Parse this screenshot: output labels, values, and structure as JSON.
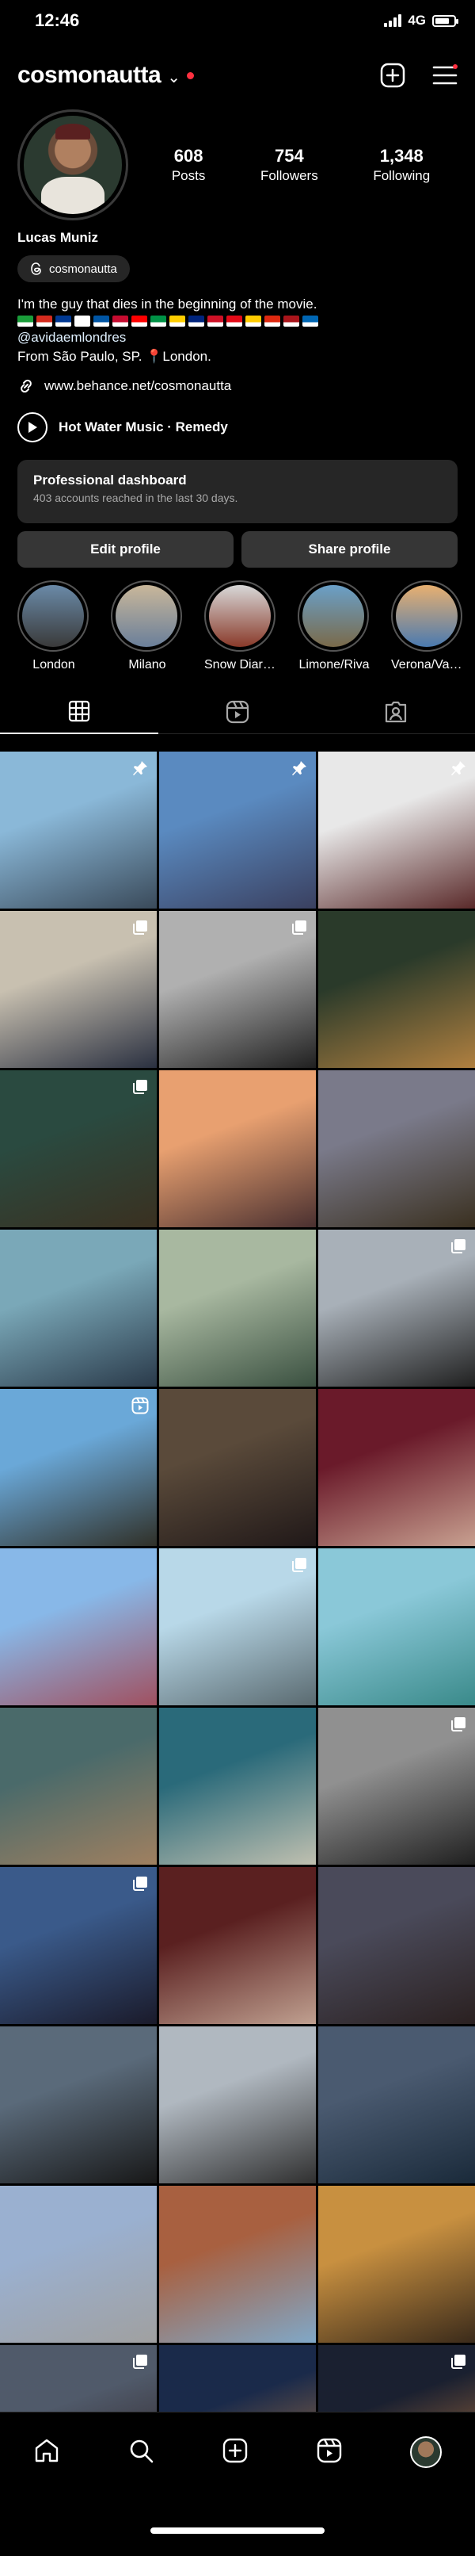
{
  "status": {
    "time": "12:46",
    "network": "4G",
    "battery_level": 0.75
  },
  "header": {
    "username": "cosmonautta",
    "icons": [
      "new-post-icon",
      "menu-icon"
    ]
  },
  "profile": {
    "stats": [
      {
        "value": "608",
        "label": "Posts"
      },
      {
        "value": "754",
        "label": "Followers"
      },
      {
        "value": "1,348",
        "label": "Following"
      }
    ],
    "name": "Lucas Muniz",
    "threads_handle": "cosmonautta",
    "bio_line1": "I'm the guy that dies in the beginning of the movie.",
    "flag_colors": [
      "#1a9d3a",
      "#d52b1e",
      "#003893",
      "#ffffff",
      "#0055a4",
      "#c60c30",
      "#ff0000",
      "#009246",
      "#ffce00",
      "#00247d",
      "#ce1126",
      "#e30a17",
      "#ffcc00",
      "#de2910",
      "#aa151b",
      "#0066b3"
    ],
    "mention": "@avidaemlondres",
    "location": "From São Paulo, SP. 📍London.",
    "link": "www.behance.net/cosmonautta",
    "music": "Hot Water Music · Remedy"
  },
  "dashboard": {
    "title": "Professional dashboard",
    "subtitle": "403 accounts reached in the last 30 days."
  },
  "buttons": {
    "edit": "Edit profile",
    "share": "Share profile"
  },
  "highlights": [
    {
      "label": "London",
      "colors": [
        "#6a8aa8",
        "#3a3a3a"
      ]
    },
    {
      "label": "Milano",
      "colors": [
        "#c9b79a",
        "#6a7f9a"
      ]
    },
    {
      "label": "Snow Diaries",
      "colors": [
        "#d8d8d8",
        "#8a3a2a"
      ]
    },
    {
      "label": "Limone/Riva",
      "colors": [
        "#6aa0c8",
        "#7a6a4a"
      ]
    },
    {
      "label": "Verona/Vale...",
      "colors": [
        "#e8b070",
        "#4a7ab0"
      ]
    }
  ],
  "tabs": [
    "grid-icon",
    "reels-icon",
    "tagged-icon"
  ],
  "posts": [
    {
      "desc": "sunset lake",
      "colors": [
        "#8ab8d8",
        "#3a4a5a"
      ],
      "badge": "pin-icon"
    },
    {
      "desc": "tower bridge couple",
      "colors": [
        "#5a8ac0",
        "#3a4060"
      ],
      "badge": "pin-icon"
    },
    {
      "desc": "ski goggles",
      "colors": [
        "#e8e8e8",
        "#5a2a2a"
      ],
      "badge": "pin-icon"
    },
    {
      "desc": "cafe sofa",
      "colors": [
        "#c8c0b0",
        "#2a3040"
      ],
      "badge": "carousel-icon"
    },
    {
      "desc": "mirror selfie bw",
      "colors": [
        "#b0b0b0",
        "#202020"
      ],
      "badge": "carousel-icon"
    },
    {
      "desc": "pub beer",
      "colors": [
        "#2a3a2a",
        "#b08040"
      ],
      "badge": ""
    },
    {
      "desc": "canal trees",
      "colors": [
        "#2a4a40",
        "#3a3020"
      ],
      "badge": "carousel-icon"
    },
    {
      "desc": "seaside portrait",
      "colors": [
        "#e8a070",
        "#4a3030"
      ],
      "badge": ""
    },
    {
      "desc": "westminster",
      "colors": [
        "#7a7a8a",
        "#3a3020"
      ],
      "badge": ""
    },
    {
      "desc": "canary wharf",
      "colors": [
        "#7aa8b8",
        "#2a3a4a"
      ],
      "badge": ""
    },
    {
      "desc": "autumn canal",
      "colors": [
        "#a8b8a0",
        "#3a5040"
      ],
      "badge": ""
    },
    {
      "desc": "couple street",
      "colors": [
        "#a8b0b8",
        "#202020"
      ],
      "badge": "carousel-icon"
    },
    {
      "desc": "palm window",
      "colors": [
        "#6aa8d8",
        "#303028"
      ],
      "badge": "reels-icon"
    },
    {
      "desc": "woman portrait",
      "colors": [
        "#5a4a3a",
        "#201818"
      ],
      "badge": ""
    },
    {
      "desc": "woman cap",
      "colors": [
        "#6a1a2a",
        "#c8a090"
      ],
      "badge": ""
    },
    {
      "desc": "brighton street",
      "colors": [
        "#88b8e8",
        "#a05060"
      ],
      "badge": ""
    },
    {
      "desc": "seagulls pier",
      "colors": [
        "#b8d8e8",
        "#5a6a70"
      ],
      "badge": "carousel-icon"
    },
    {
      "desc": "upside down house",
      "colors": [
        "#8ac8d8",
        "#3a8a8a"
      ],
      "badge": ""
    },
    {
      "desc": "beach green jacket",
      "colors": [
        "#4a6a6a",
        "#a08060"
      ],
      "badge": ""
    },
    {
      "desc": "brighton pier",
      "colors": [
        "#2a6a7a",
        "#c0c0b0"
      ],
      "badge": ""
    },
    {
      "desc": "two men bw",
      "colors": [
        "#909090",
        "#202020"
      ],
      "badge": "carousel-icon"
    },
    {
      "desc": "group selfie",
      "colors": [
        "#3a5a8a",
        "#1a1a2a"
      ],
      "badge": "carousel-icon"
    },
    {
      "desc": "couple red",
      "colors": [
        "#5a2020",
        "#c0a090"
      ],
      "badge": ""
    },
    {
      "desc": "street dusk",
      "colors": [
        "#4a4a5a",
        "#2a2020"
      ],
      "badge": ""
    },
    {
      "desc": "dark street",
      "colors": [
        "#5a6a7a",
        "#181818"
      ],
      "badge": ""
    },
    {
      "desc": "st pauls street",
      "colors": [
        "#b0b8c0",
        "#303030"
      ],
      "badge": ""
    },
    {
      "desc": "foggy city",
      "colors": [
        "#4a5a70",
        "#1a2a3a"
      ],
      "badge": ""
    },
    {
      "desc": "st pauls cathedral",
      "colors": [
        "#9ab0d0",
        "#a0a0a0"
      ],
      "badge": ""
    },
    {
      "desc": "narrow lane",
      "colors": [
        "#a86040",
        "#80a8c8"
      ],
      "badge": ""
    },
    {
      "desc": "bar portrait",
      "colors": [
        "#c89040",
        "#3a2a1a"
      ],
      "badge": ""
    },
    {
      "desc": "crowd street",
      "colors": [
        "#505a6a",
        "#2a1a1a"
      ],
      "badge": "carousel-icon"
    },
    {
      "desc": "big ben night",
      "colors": [
        "#1a2a4a",
        "#c08040"
      ],
      "badge": ""
    },
    {
      "desc": "night skyline",
      "colors": [
        "#1a2030",
        "#c88040"
      ],
      "badge": "carousel-icon"
    }
  ],
  "bottom_nav": [
    "home-icon",
    "search-icon",
    "create-icon",
    "reels-icon",
    "profile-avatar"
  ]
}
